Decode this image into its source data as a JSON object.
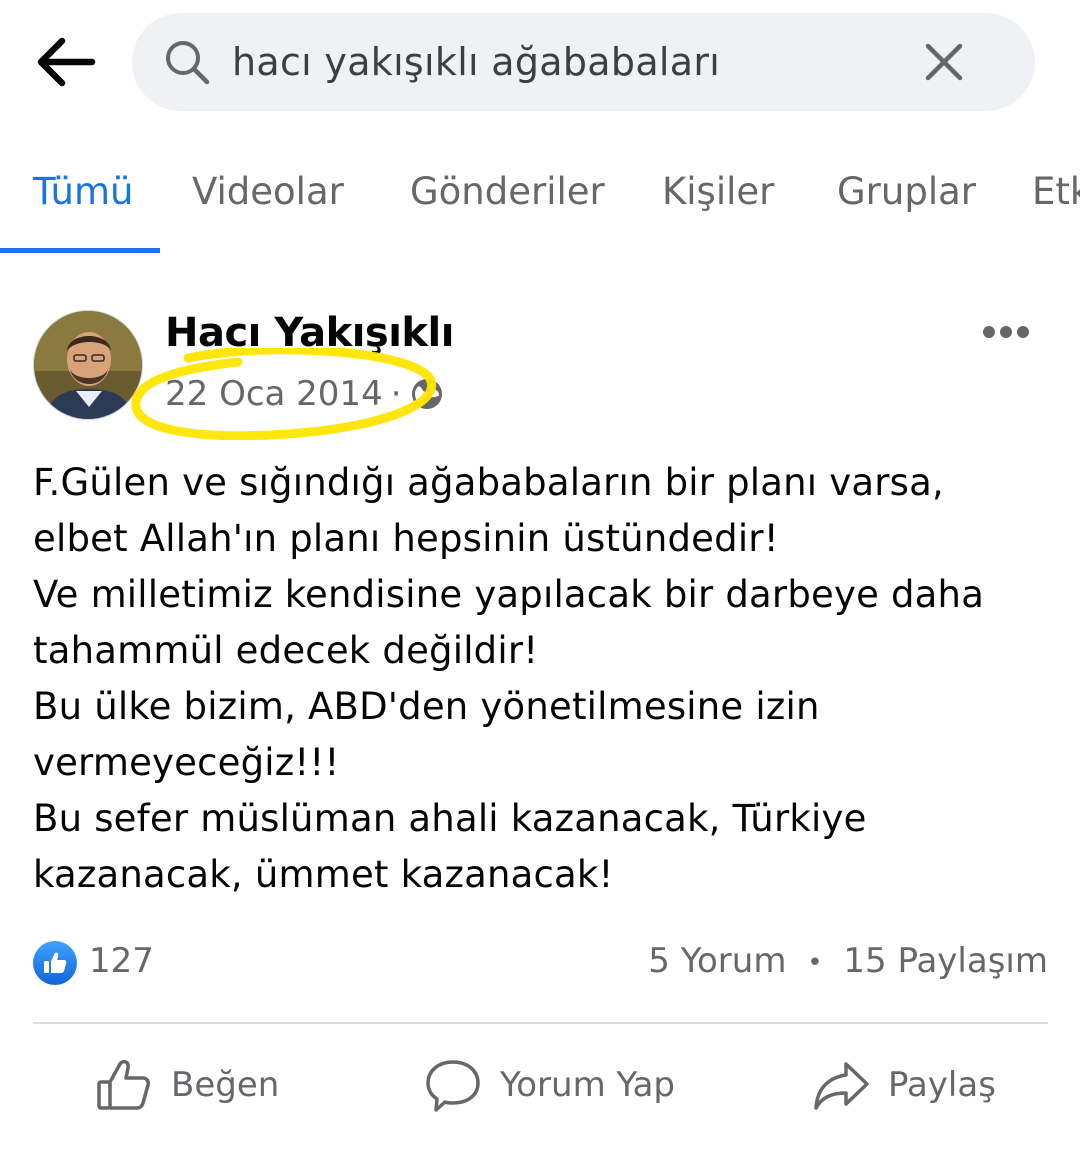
{
  "search": {
    "query": "hacı yakışıklı ağababaları"
  },
  "tabs": [
    {
      "label": "Tümü",
      "active": true
    },
    {
      "label": "Videolar",
      "active": false
    },
    {
      "label": "Gönderiler",
      "active": false
    },
    {
      "label": "Kişiler",
      "active": false
    },
    {
      "label": "Gruplar",
      "active": false
    },
    {
      "label": "Etk",
      "active": false
    }
  ],
  "post": {
    "author": "Hacı Yakışıklı",
    "date": "22 Oca 2014",
    "separator": "·",
    "lines": [
      "F.Gülen ve sığındığı ağababaların bir planı varsa,",
      "elbet Allah'ın planı hepsinin üstündedir!",
      "Ve milletimiz kendisine yapılacak bir darbeye daha",
      "tahammül edecek değildir!",
      "Bu ülke bizim, ABD'den yönetilmesine izin",
      "vermeyeceğiz!!!",
      "Bu sefer müslüman ahali kazanacak, Türkiye",
      "kazanacak, ümmet kazanacak!"
    ],
    "likes": "127",
    "comments": "5 Yorum",
    "stats_separator": "•",
    "shares": "15 Paylaşım"
  },
  "actions": {
    "like": "Beğen",
    "comment": "Yorum Yap",
    "share": "Paylaş"
  },
  "colors": {
    "accent": "#1b74e4",
    "highlight": "#ffe600",
    "muted_text": "#65676b"
  }
}
